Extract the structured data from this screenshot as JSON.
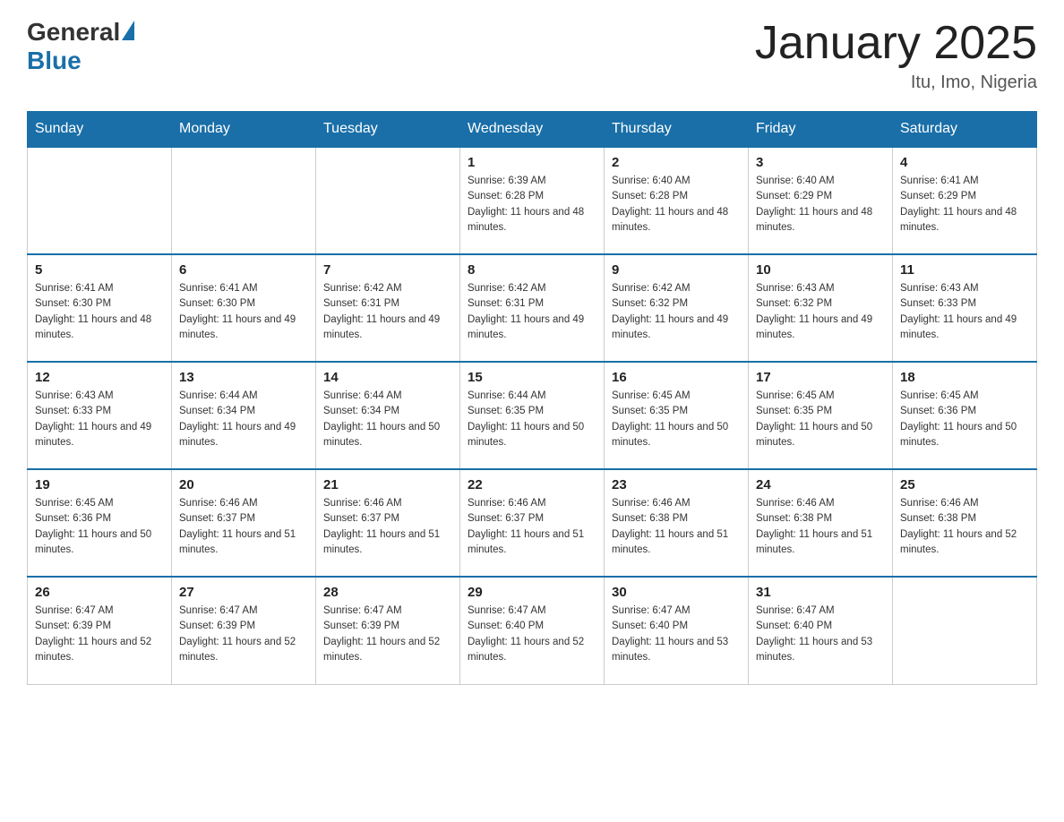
{
  "header": {
    "logo_general": "General",
    "logo_blue": "Blue",
    "title": "January 2025",
    "subtitle": "Itu, Imo, Nigeria"
  },
  "days_of_week": [
    "Sunday",
    "Monday",
    "Tuesday",
    "Wednesday",
    "Thursday",
    "Friday",
    "Saturday"
  ],
  "weeks": [
    [
      {
        "day": "",
        "info": ""
      },
      {
        "day": "",
        "info": ""
      },
      {
        "day": "",
        "info": ""
      },
      {
        "day": "1",
        "info": "Sunrise: 6:39 AM\nSunset: 6:28 PM\nDaylight: 11 hours and 48 minutes."
      },
      {
        "day": "2",
        "info": "Sunrise: 6:40 AM\nSunset: 6:28 PM\nDaylight: 11 hours and 48 minutes."
      },
      {
        "day": "3",
        "info": "Sunrise: 6:40 AM\nSunset: 6:29 PM\nDaylight: 11 hours and 48 minutes."
      },
      {
        "day": "4",
        "info": "Sunrise: 6:41 AM\nSunset: 6:29 PM\nDaylight: 11 hours and 48 minutes."
      }
    ],
    [
      {
        "day": "5",
        "info": "Sunrise: 6:41 AM\nSunset: 6:30 PM\nDaylight: 11 hours and 48 minutes."
      },
      {
        "day": "6",
        "info": "Sunrise: 6:41 AM\nSunset: 6:30 PM\nDaylight: 11 hours and 49 minutes."
      },
      {
        "day": "7",
        "info": "Sunrise: 6:42 AM\nSunset: 6:31 PM\nDaylight: 11 hours and 49 minutes."
      },
      {
        "day": "8",
        "info": "Sunrise: 6:42 AM\nSunset: 6:31 PM\nDaylight: 11 hours and 49 minutes."
      },
      {
        "day": "9",
        "info": "Sunrise: 6:42 AM\nSunset: 6:32 PM\nDaylight: 11 hours and 49 minutes."
      },
      {
        "day": "10",
        "info": "Sunrise: 6:43 AM\nSunset: 6:32 PM\nDaylight: 11 hours and 49 minutes."
      },
      {
        "day": "11",
        "info": "Sunrise: 6:43 AM\nSunset: 6:33 PM\nDaylight: 11 hours and 49 minutes."
      }
    ],
    [
      {
        "day": "12",
        "info": "Sunrise: 6:43 AM\nSunset: 6:33 PM\nDaylight: 11 hours and 49 minutes."
      },
      {
        "day": "13",
        "info": "Sunrise: 6:44 AM\nSunset: 6:34 PM\nDaylight: 11 hours and 49 minutes."
      },
      {
        "day": "14",
        "info": "Sunrise: 6:44 AM\nSunset: 6:34 PM\nDaylight: 11 hours and 50 minutes."
      },
      {
        "day": "15",
        "info": "Sunrise: 6:44 AM\nSunset: 6:35 PM\nDaylight: 11 hours and 50 minutes."
      },
      {
        "day": "16",
        "info": "Sunrise: 6:45 AM\nSunset: 6:35 PM\nDaylight: 11 hours and 50 minutes."
      },
      {
        "day": "17",
        "info": "Sunrise: 6:45 AM\nSunset: 6:35 PM\nDaylight: 11 hours and 50 minutes."
      },
      {
        "day": "18",
        "info": "Sunrise: 6:45 AM\nSunset: 6:36 PM\nDaylight: 11 hours and 50 minutes."
      }
    ],
    [
      {
        "day": "19",
        "info": "Sunrise: 6:45 AM\nSunset: 6:36 PM\nDaylight: 11 hours and 50 minutes."
      },
      {
        "day": "20",
        "info": "Sunrise: 6:46 AM\nSunset: 6:37 PM\nDaylight: 11 hours and 51 minutes."
      },
      {
        "day": "21",
        "info": "Sunrise: 6:46 AM\nSunset: 6:37 PM\nDaylight: 11 hours and 51 minutes."
      },
      {
        "day": "22",
        "info": "Sunrise: 6:46 AM\nSunset: 6:37 PM\nDaylight: 11 hours and 51 minutes."
      },
      {
        "day": "23",
        "info": "Sunrise: 6:46 AM\nSunset: 6:38 PM\nDaylight: 11 hours and 51 minutes."
      },
      {
        "day": "24",
        "info": "Sunrise: 6:46 AM\nSunset: 6:38 PM\nDaylight: 11 hours and 51 minutes."
      },
      {
        "day": "25",
        "info": "Sunrise: 6:46 AM\nSunset: 6:38 PM\nDaylight: 11 hours and 52 minutes."
      }
    ],
    [
      {
        "day": "26",
        "info": "Sunrise: 6:47 AM\nSunset: 6:39 PM\nDaylight: 11 hours and 52 minutes."
      },
      {
        "day": "27",
        "info": "Sunrise: 6:47 AM\nSunset: 6:39 PM\nDaylight: 11 hours and 52 minutes."
      },
      {
        "day": "28",
        "info": "Sunrise: 6:47 AM\nSunset: 6:39 PM\nDaylight: 11 hours and 52 minutes."
      },
      {
        "day": "29",
        "info": "Sunrise: 6:47 AM\nSunset: 6:40 PM\nDaylight: 11 hours and 52 minutes."
      },
      {
        "day": "30",
        "info": "Sunrise: 6:47 AM\nSunset: 6:40 PM\nDaylight: 11 hours and 53 minutes."
      },
      {
        "day": "31",
        "info": "Sunrise: 6:47 AM\nSunset: 6:40 PM\nDaylight: 11 hours and 53 minutes."
      },
      {
        "day": "",
        "info": ""
      }
    ]
  ]
}
